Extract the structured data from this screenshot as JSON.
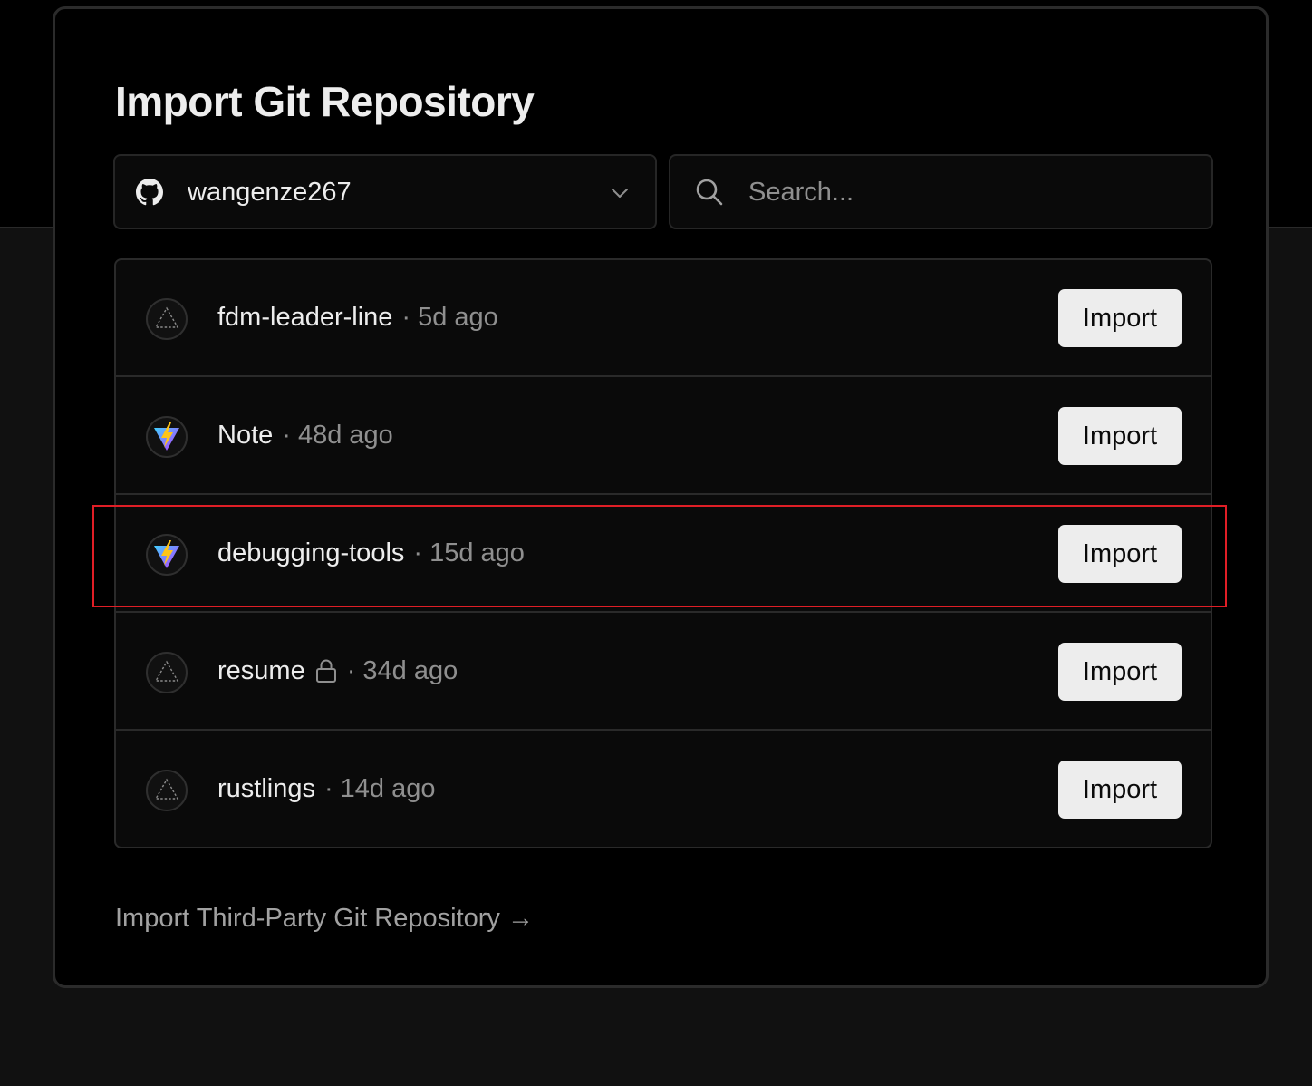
{
  "title": "Import Git Repository",
  "account": {
    "name": "wangenze267",
    "icon": "github-icon"
  },
  "search": {
    "placeholder": "Search...",
    "value": ""
  },
  "repos": [
    {
      "name": "fdm-leader-line",
      "separator": "·",
      "age": "5d ago",
      "private": false,
      "icon": "vercel-triangle-icon",
      "import_label": "Import"
    },
    {
      "name": "Note",
      "separator": "·",
      "age": "48d ago",
      "private": false,
      "icon": "vite-icon",
      "import_label": "Import"
    },
    {
      "name": "debugging-tools",
      "separator": "·",
      "age": "15d ago",
      "private": false,
      "icon": "vite-icon",
      "import_label": "Import"
    },
    {
      "name": "resume",
      "separator": "·",
      "age": "34d ago",
      "private": true,
      "icon": "vercel-triangle-icon",
      "import_label": "Import"
    },
    {
      "name": "rustlings",
      "separator": "·",
      "age": "14d ago",
      "private": false,
      "icon": "vercel-triangle-icon",
      "import_label": "Import"
    }
  ],
  "third_party_link": "Import Third-Party Git Repository →",
  "colors": {
    "background": "#000000",
    "text": "#ededed",
    "muted": "#8f8f8f",
    "button_bg": "#ededed",
    "highlight": "#e01e26"
  }
}
